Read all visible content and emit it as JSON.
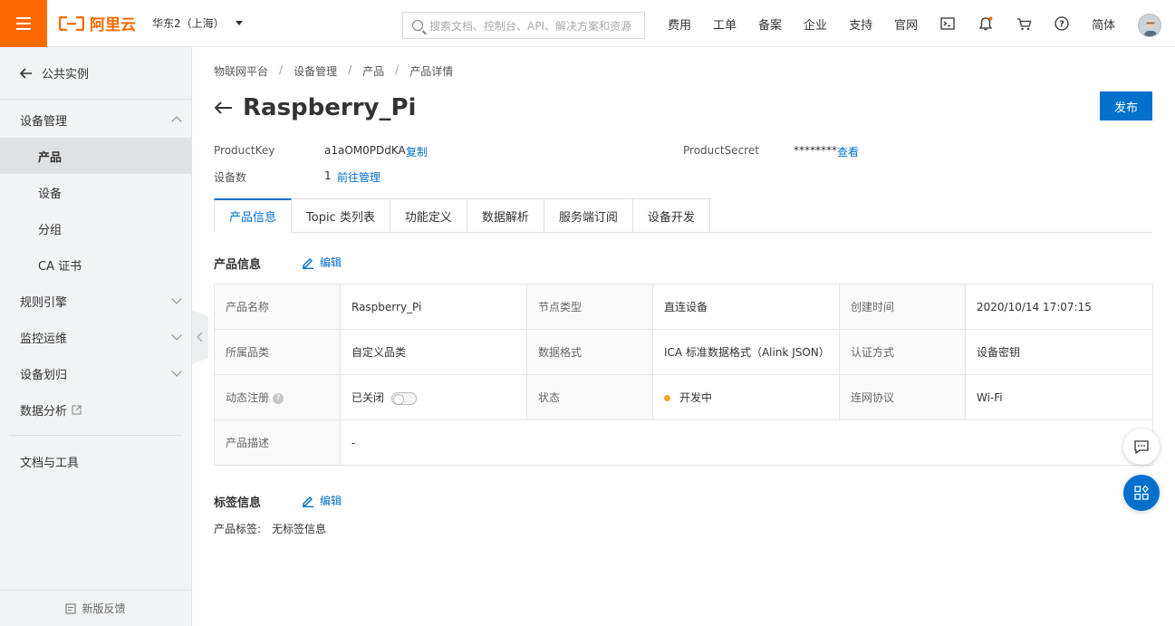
{
  "topbar": {
    "logo_text": "阿里云",
    "region": "华东2（上海）",
    "search_placeholder": "搜索文档、控制台、API、解决方案和资源",
    "nav": [
      "费用",
      "工单",
      "备案",
      "企业",
      "支持",
      "官网"
    ],
    "lang": "简体",
    "icons": [
      "terminal-icon",
      "bell-icon",
      "cart-icon",
      "help-icon"
    ],
    "accent": "#ff6a00"
  },
  "sidebar": {
    "back_label": "公共实例",
    "groups": {
      "device_mgmt": "设备管理",
      "items": [
        "产品",
        "设备",
        "分组",
        "CA 证书"
      ],
      "rules": "规则引擎",
      "monitor": "监控运维",
      "assign": "设备划归",
      "analytics": "数据分析",
      "docs": "文档与工具"
    },
    "feedback": "新版反馈"
  },
  "breadcrumb": [
    "物联网平台",
    "设备管理",
    "产品",
    "产品详情"
  ],
  "page": {
    "title": "Raspberry_Pi",
    "publish": "发布",
    "product_key_label": "ProductKey",
    "product_key": "a1aOM0PDdKA",
    "copy": "复制",
    "secret_label": "ProductSecret",
    "secret": "********",
    "view": "查看",
    "device_count_label": "设备数",
    "device_count": "1",
    "goto_manage": "前往管理"
  },
  "tabs": [
    "产品信息",
    "Topic 类列表",
    "功能定义",
    "数据解析",
    "服务端订阅",
    "设备开发"
  ],
  "info": {
    "section_title": "产品信息",
    "edit": "编辑",
    "rows": [
      [
        "产品名称",
        "Raspberry_Pi",
        "节点类型",
        "直连设备",
        "创建时间",
        "2020/10/14 17:07:15"
      ],
      [
        "所属品类",
        "自定义品类",
        "数据格式",
        "ICA 标准数据格式（Alink JSON）",
        "认证方式",
        "设备密钥"
      ],
      [
        "动态注册",
        "已关闭",
        "状态",
        "开发中",
        "连网协议",
        "Wi-Fi"
      ]
    ],
    "desc_label": "产品描述",
    "desc_value": "-"
  },
  "tags": {
    "section_title": "标签信息",
    "edit": "编辑",
    "label": "产品标签:",
    "value": "无标签信息"
  }
}
